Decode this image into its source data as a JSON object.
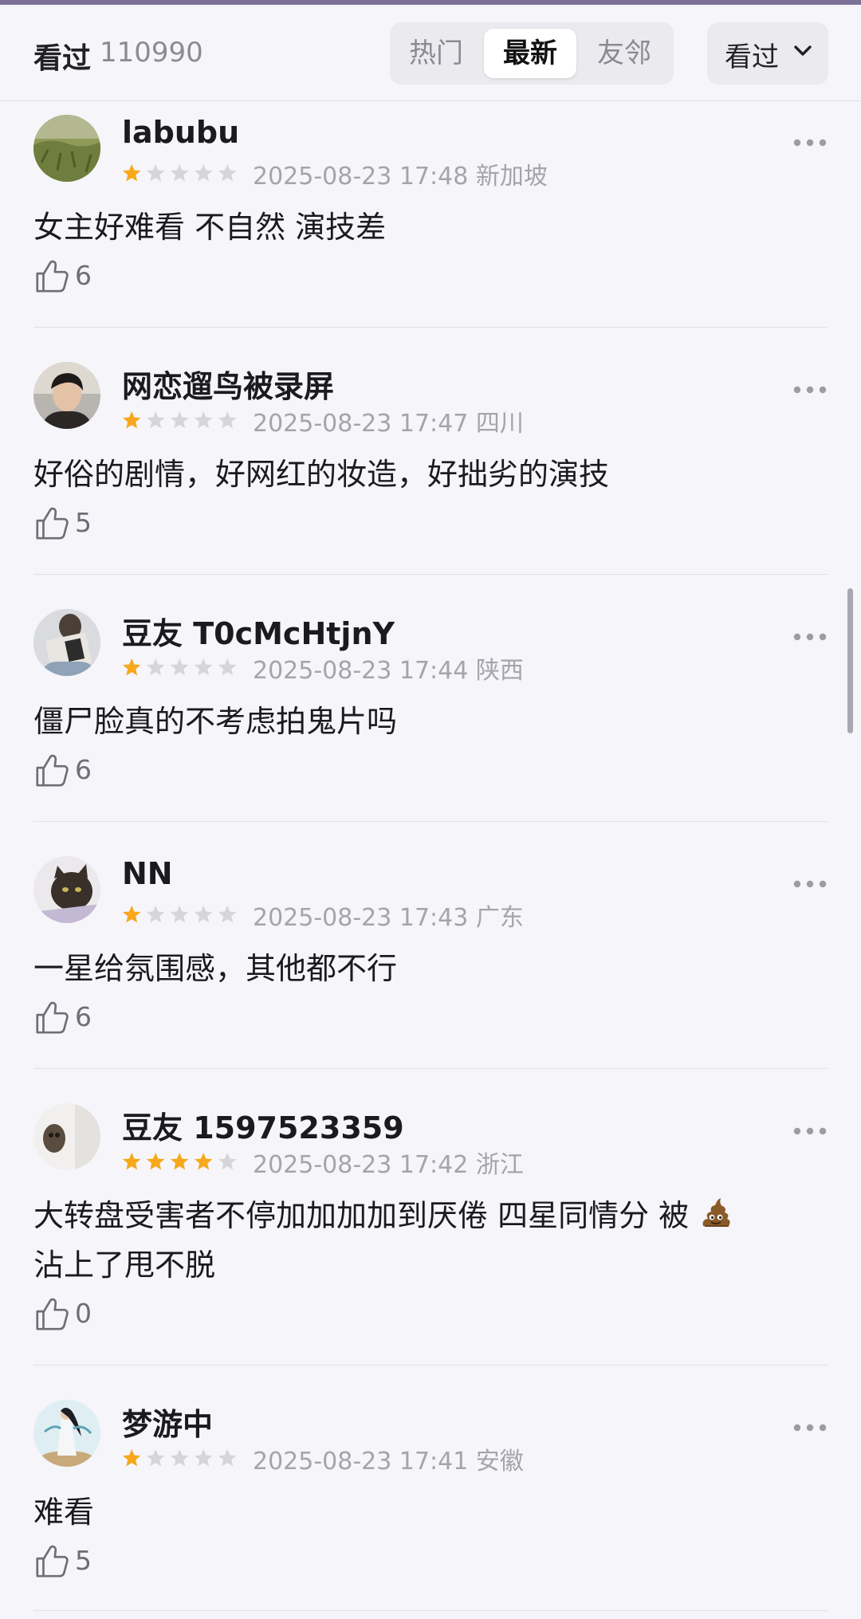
{
  "header": {
    "title": "看过",
    "count": "110990",
    "tabs": [
      {
        "label": "热门",
        "active": false
      },
      {
        "label": "最新",
        "active": true
      },
      {
        "label": "友邻",
        "active": false
      }
    ],
    "filter_label": "看过",
    "filter_icon": "chevron-down-icon"
  },
  "colors": {
    "star_filled": "#f7a81b",
    "star_empty": "#d6d6d9",
    "accent_bar": "#7b7196"
  },
  "reviews": [
    {
      "user": "labubu",
      "rating": 1,
      "max_rating": 5,
      "time": "2025-08-23 17:48",
      "location": "新加坡",
      "content": "女主好难看 不自然 演技差",
      "content_suffix": "",
      "content_line2": "",
      "likes": "6"
    },
    {
      "user": "网恋遛鸟被录屏",
      "rating": 1,
      "max_rating": 5,
      "time": "2025-08-23 17:47",
      "location": "四川",
      "content": "好俗的剧情，好网红的妆造，好拙劣的演技",
      "content_suffix": "",
      "content_line2": "",
      "likes": "5"
    },
    {
      "user": "豆友 T0cMcHtjnY",
      "rating": 1,
      "max_rating": 5,
      "time": "2025-08-23 17:44",
      "location": "陕西",
      "content": "僵尸脸真的不考虑拍鬼片吗",
      "content_suffix": "",
      "content_line2": "",
      "likes": "6"
    },
    {
      "user": "NN",
      "rating": 1,
      "max_rating": 5,
      "time": "2025-08-23 17:43",
      "location": "广东",
      "content": "一星给氛围感，其他都不行",
      "content_suffix": "",
      "content_line2": "",
      "likes": "6"
    },
    {
      "user": "豆友 1597523359",
      "rating": 4,
      "max_rating": 5,
      "time": "2025-08-23 17:42",
      "location": "浙江",
      "content": "大转盘受害者不停加加加加到厌倦 四星同情分 被",
      "content_emoji": "pile-of-poo-icon",
      "content_line2": "沾上了甩不脱",
      "likes": "0"
    },
    {
      "user": "梦游中",
      "rating": 1,
      "max_rating": 5,
      "time": "2025-08-23 17:41",
      "location": "安徽",
      "content": "难看",
      "content_suffix": "",
      "content_line2": "",
      "likes": "5"
    }
  ]
}
